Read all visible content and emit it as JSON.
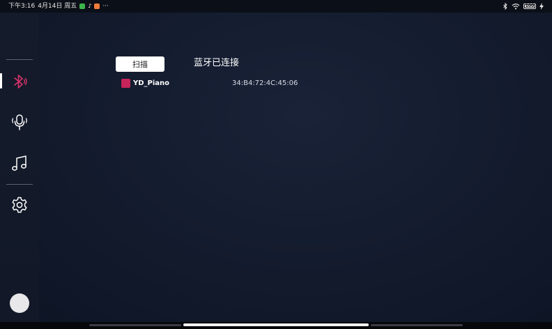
{
  "status_bar": {
    "time": "下午3:16",
    "date": "4月14日 周五",
    "more": "···",
    "battery": "100",
    "notif_colors": [
      "#3bb54a",
      "#ffffff",
      "#ee7b3a"
    ]
  },
  "sidebar": {
    "items": [
      {
        "id": "bluetooth",
        "icon": "bluetooth-icon",
        "active": true,
        "color": "#d8336b"
      },
      {
        "id": "microphone",
        "icon": "microphone-icon",
        "active": false
      },
      {
        "id": "music",
        "icon": "music-note-icon",
        "active": false
      },
      {
        "id": "settings",
        "icon": "gear-icon",
        "active": false
      }
    ]
  },
  "main": {
    "scan_label": "扫描",
    "connection_status": "蓝牙已连接",
    "devices": [
      {
        "name": "YD_Piano",
        "mac": "34:B4:72:4C:45:06",
        "color": "#c7245a"
      }
    ]
  }
}
